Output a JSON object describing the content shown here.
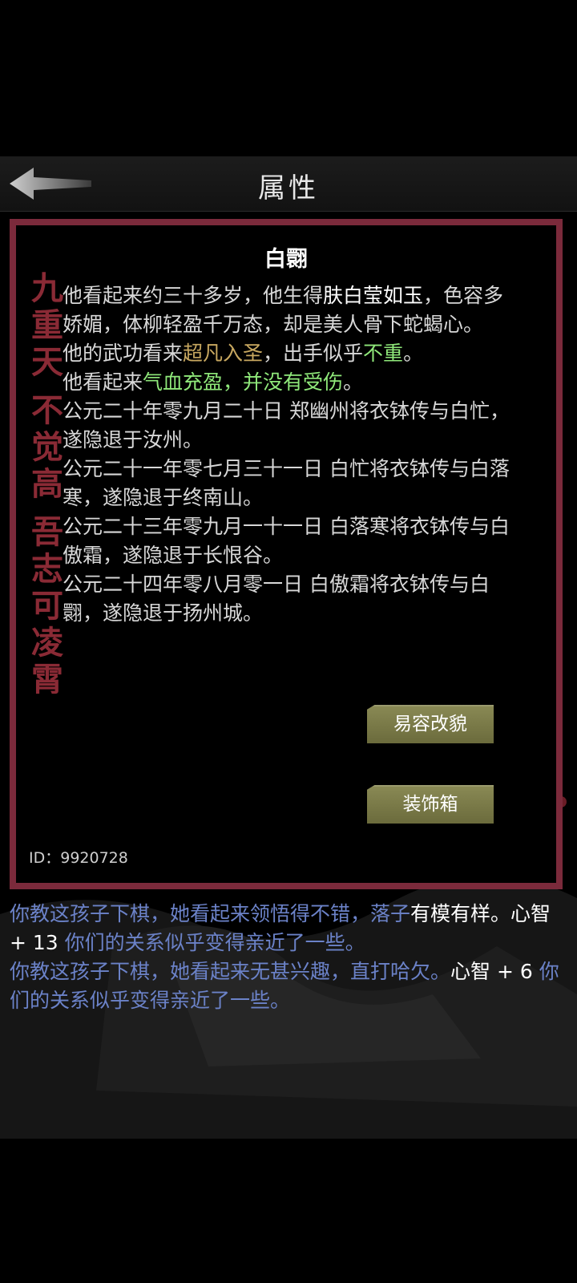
{
  "header": {
    "title": "属性",
    "back_icon": "back-arrow-icon"
  },
  "character": {
    "name": "白翾",
    "description": [
      [
        {
          "t": "他看起来约三十多岁，他生得",
          "c": ""
        },
        {
          "t": "肤白莹如玉",
          "c": "white"
        },
        {
          "t": "，色容多娇媚，体柳轻盈千万态，却是美人骨下蛇蝎心。",
          "c": ""
        }
      ],
      [
        {
          "t": "他的武功看来",
          "c": ""
        },
        {
          "t": "超凡入圣",
          "c": "gold"
        },
        {
          "t": "，出手似乎",
          "c": ""
        },
        {
          "t": "不重",
          "c": "green"
        },
        {
          "t": "。",
          "c": ""
        }
      ],
      [
        {
          "t": "他看起来",
          "c": ""
        },
        {
          "t": "气血充盈，并没有受伤",
          "c": "green"
        },
        {
          "t": "。",
          "c": ""
        }
      ],
      [
        {
          "t": "公元二十年零九月二十日 郑幽州将衣钵传与白忙，遂隐退于汝州。",
          "c": ""
        }
      ],
      [
        {
          "t": "公元二十一年零七月三十一日 白忙将衣钵传与白落寒，遂隐退于终南山。",
          "c": ""
        }
      ],
      [
        {
          "t": "公元二十三年零九月一十一日 白落寒将衣钵传与白傲霜，遂隐退于长恨谷。",
          "c": ""
        }
      ],
      [
        {
          "t": "公元二十四年零八月零一日 白傲霜将衣钵传与白翾，遂隐退于扬州城。",
          "c": ""
        }
      ]
    ],
    "id_label": "ID：9920728"
  },
  "calligraphy": [
    "九",
    "重",
    "天",
    "",
    "不",
    "觉",
    "高",
    "",
    "吾",
    "志",
    "可",
    "凌",
    "霄"
  ],
  "buttons": {
    "disguise": "易容改貌",
    "wardrobe": "装饰箱"
  },
  "log": [
    [
      {
        "t": "你教这孩子下棋，她看起来领悟得不错，落子",
        "c": ""
      },
      {
        "t": "有模有样",
        "c": "w"
      },
      {
        "t": "。",
        "c": "w"
      },
      {
        "t": "心智 + 13 ",
        "c": "w"
      },
      {
        "t": "你们的关系似乎变得亲近了一些。",
        "c": ""
      }
    ],
    [
      {
        "t": "你教这孩子下棋，她看起来无甚兴趣，直打哈欠。",
        "c": ""
      },
      {
        "t": "心智 + 6 ",
        "c": "w"
      },
      {
        "t": "你们的关系似乎变得亲近了一些。",
        "c": ""
      }
    ]
  ],
  "colors": {
    "panel_border": "#7b2a3b",
    "log_text": "#6b82c8",
    "highlight_gold": "#c8a860",
    "highlight_green": "#8fe87a",
    "button": "#7a7a48"
  }
}
